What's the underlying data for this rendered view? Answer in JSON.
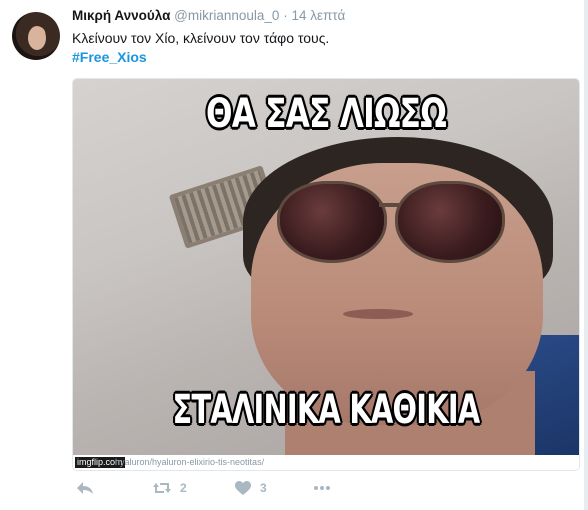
{
  "tweet": {
    "display_name": "Μικρή Αννούλα",
    "handle": "@mikriannoula_0",
    "separator": "·",
    "time": "14 λεπτά",
    "text": "Κλείνουν τον Χίο, κλείνουν τον τάφο τους.",
    "hashtag": "#Free_Xios"
  },
  "media": {
    "meme_top_text": "ΘΑ ΣΑΣ ΛΙΩΣΩ",
    "meme_bottom_text": "ΣΤΑΛΙΝΙΚΑ ΚΑΘΙΚΙΑ",
    "watermark": "imgflip.com",
    "image_url": "hyaluron/hyaluron-elixirio-tis-neotitas/"
  },
  "actions": {
    "retweet_count": "2",
    "like_count": "3"
  },
  "icons": {
    "reply": "reply-icon",
    "retweet": "retweet-icon",
    "like": "heart-icon",
    "more": "more-icon"
  },
  "colors": {
    "hashtag": "#1b95e0",
    "muted": "#8899a6",
    "action": "#aab8c2"
  }
}
